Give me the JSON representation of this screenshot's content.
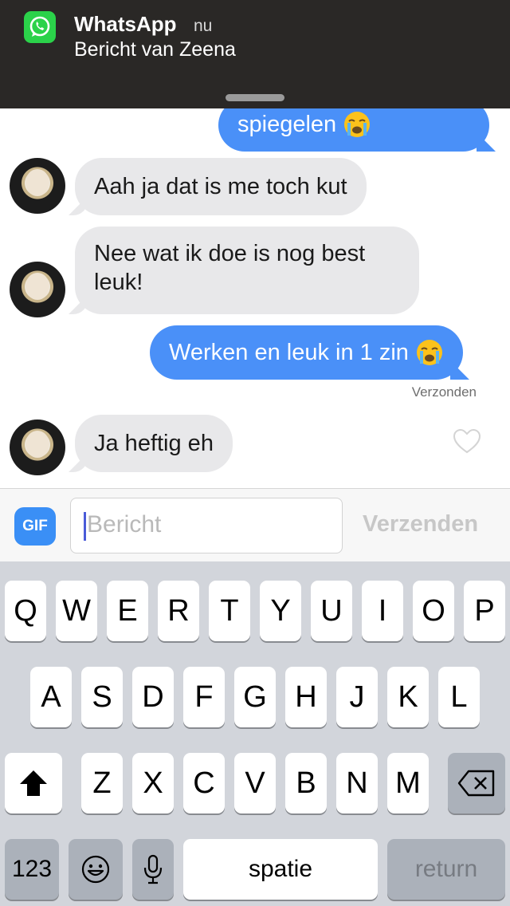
{
  "notification": {
    "app": "WhatsApp",
    "time": "nu",
    "message": "Bericht van Zeena",
    "icon": "whatsapp-icon"
  },
  "messages": [
    {
      "direction": "out",
      "text": "spiegelen",
      "emoji": "loudly-crying-face"
    },
    {
      "direction": "in",
      "text": "Aah ja dat is me toch kut"
    },
    {
      "direction": "in",
      "text": "Nee wat ik doe is nog best leuk!"
    },
    {
      "direction": "out",
      "text": "Werken en leuk in 1 zin",
      "emoji": "loudly-crying-face"
    },
    {
      "direction": "in",
      "text": "Ja heftig eh"
    }
  ],
  "delivery_status": "Verzonden",
  "input": {
    "gif_label": "GIF",
    "placeholder": "Bericht",
    "value": "",
    "send_label": "Verzenden"
  },
  "keyboard": {
    "row1": [
      "Q",
      "W",
      "E",
      "R",
      "T",
      "Y",
      "U",
      "I",
      "O",
      "P"
    ],
    "row2": [
      "A",
      "S",
      "D",
      "F",
      "G",
      "H",
      "J",
      "K",
      "L"
    ],
    "row3": [
      "Z",
      "X",
      "C",
      "V",
      "B",
      "N",
      "M"
    ],
    "numbers_label": "123",
    "space_label": "spatie",
    "return_label": "return"
  },
  "colors": {
    "outgoing_bubble": "#4a90f8",
    "incoming_bubble": "#e8e8ea",
    "whatsapp_green": "#2bd24a",
    "gif_button": "#3a8ff6"
  }
}
